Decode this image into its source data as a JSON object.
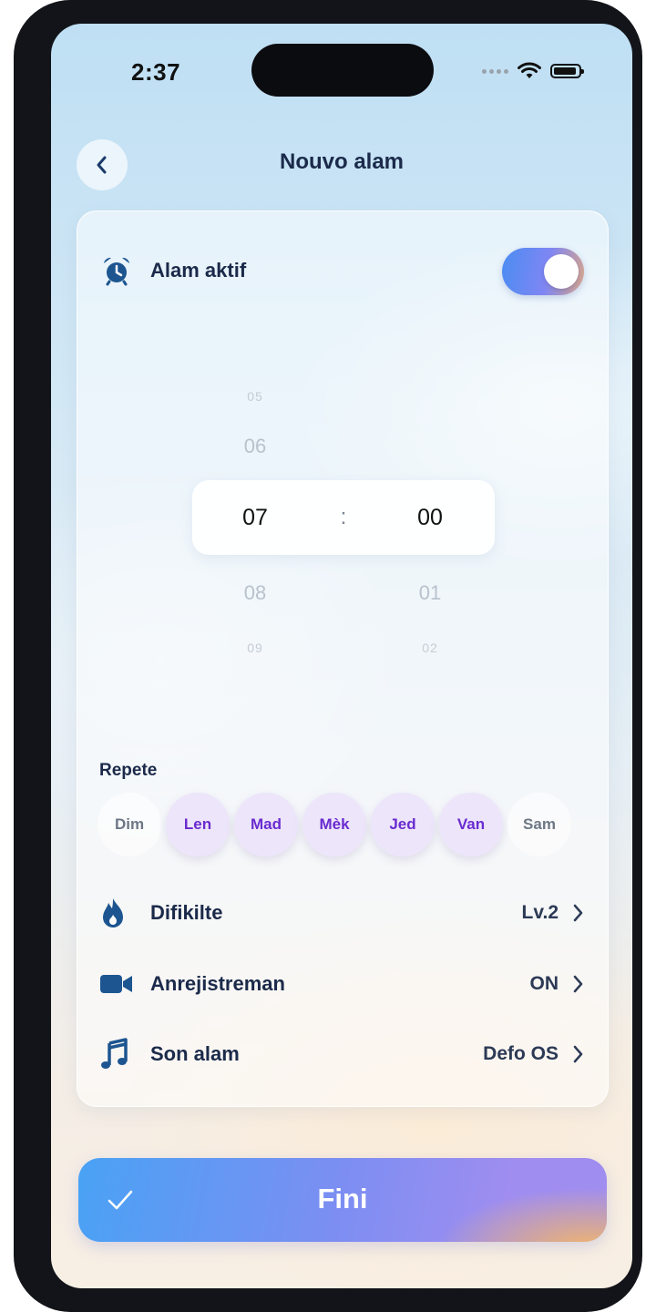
{
  "status_bar": {
    "time": "2:37"
  },
  "nav": {
    "title": "Nouvo alam"
  },
  "alarm_active": {
    "label": "Alam aktif",
    "enabled": true
  },
  "time_picker": {
    "hours": {
      "far_above": "05",
      "above": "06",
      "selected": "07",
      "below": "08",
      "far_below": "09"
    },
    "minutes": {
      "selected": "00",
      "below": "01",
      "far_below": "02"
    },
    "separator": ":"
  },
  "repeat": {
    "label": "Repete",
    "days": [
      {
        "label": "Dim",
        "selected": false
      },
      {
        "label": "Len",
        "selected": true
      },
      {
        "label": "Mad",
        "selected": true
      },
      {
        "label": "Mèk",
        "selected": true
      },
      {
        "label": "Jed",
        "selected": true
      },
      {
        "label": "Van",
        "selected": true
      },
      {
        "label": "Sam",
        "selected": false
      }
    ]
  },
  "settings": {
    "difficulty": {
      "label": "Difikilte",
      "value": "Lv.2",
      "icon": "flame-icon"
    },
    "recording": {
      "label": "Anrejistreman",
      "value": "ON",
      "icon": "video-camera-icon"
    },
    "sound": {
      "label": "Son alam",
      "value": "Defo OS",
      "icon": "music-note-icon"
    }
  },
  "done_button": {
    "label": "Fini"
  },
  "colors": {
    "accent_blue": "#4a8df2",
    "accent_purple": "#7f86f3",
    "accent_orange": "#f5b764",
    "day_selected_text": "#6a2bd0",
    "title_text": "#1b2a4a"
  }
}
